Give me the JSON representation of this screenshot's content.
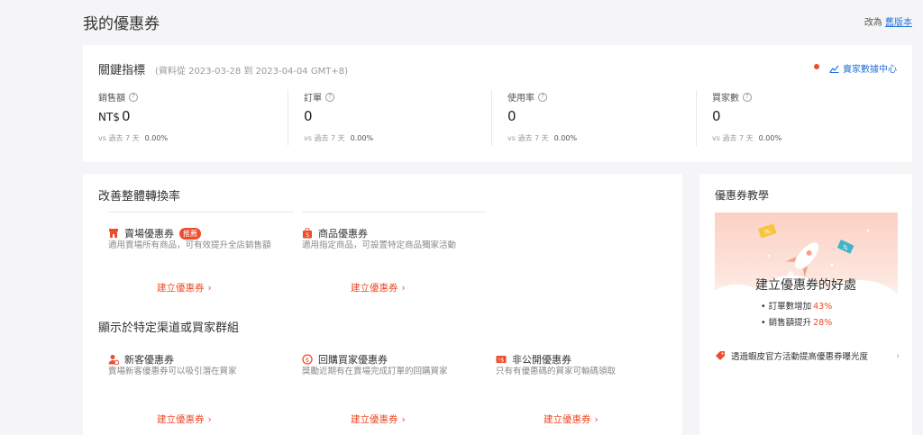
{
  "page": {
    "title": "我的優惠券",
    "switch_prefix": "改為",
    "switch_link": "舊版本"
  },
  "metrics": {
    "title": "關鍵指標",
    "range": "(資料從 2023-03-28 到 2023-04-04 GMT+8)",
    "data_center": "賣家數據中心",
    "items": [
      {
        "label": "銷售額",
        "currency": "NT$",
        "value": "0",
        "compare": "vs 過去 7 天",
        "pct": "0.00%"
      },
      {
        "label": "訂單",
        "value": "0",
        "compare": "vs 過去 7 天",
        "pct": "0.00%"
      },
      {
        "label": "使用率",
        "value": "0",
        "compare": "vs 過去 7 天",
        "pct": "0.00%"
      },
      {
        "label": "買家數",
        "value": "0",
        "compare": "vs 過去 7 天",
        "pct": "0.00%"
      }
    ]
  },
  "conversion": {
    "title": "改善整體轉換率",
    "coupons": [
      {
        "name": "賣場優惠券",
        "badge": "推薦",
        "desc": "適用賣場所有商品，可有效提升全店銷售額",
        "create": "建立優惠券",
        "icon": "shop-icon"
      },
      {
        "name": "商品優惠券",
        "desc": "適用指定商品，可設置特定商品獨家活動",
        "create": "建立優惠券",
        "icon": "bag-icon"
      }
    ]
  },
  "targeted": {
    "title": "顯示於特定渠道或買家群組",
    "coupons": [
      {
        "name": "新客優惠券",
        "desc": "賣場新客優惠券可以吸引潛在買家",
        "create": "建立優惠券",
        "icon": "new-user-icon"
      },
      {
        "name": "回購買家優惠券",
        "desc": "獎勵近期有在賣場完成訂單的回購買家",
        "create": "建立優惠券",
        "icon": "repeat-buyer-icon"
      },
      {
        "name": "非公開優惠券",
        "desc": "只有有優惠碼的買家可輸碼領取",
        "create": "建立優惠券",
        "icon": "private-coupon-icon"
      }
    ]
  },
  "tutorial": {
    "title": "優惠券教學",
    "benefit_title": "建立優惠券的好處",
    "benefits": [
      {
        "label": "• 訂單數增加",
        "value": "43%"
      },
      {
        "label": "• 銷售額提升",
        "value": "28%"
      }
    ],
    "link": "透過蝦皮官方活動提高優惠券曝光度"
  },
  "colors": {
    "accent": "#ee4d2d",
    "link": "#2673dd"
  }
}
